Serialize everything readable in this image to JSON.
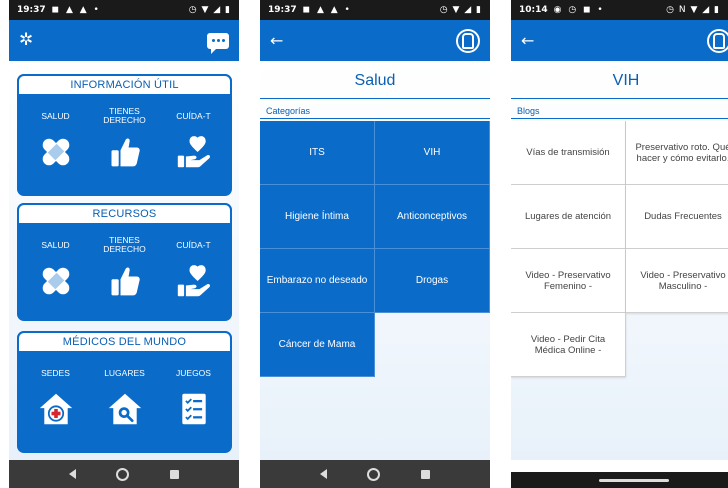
{
  "screen1": {
    "status": {
      "time": "19:37",
      "left_icons": "◼ ▲ ▲ •",
      "right_icons": "◷ ▼ ◢ ▮"
    },
    "appbar": {
      "settings_icon": "gear-icon",
      "chat_icon": "chat-icon"
    },
    "cards": [
      {
        "title": "INFORMACIÓN ÚTIL",
        "items": [
          {
            "label": "SALUD",
            "icon": "bandage-icon"
          },
          {
            "label": "TIENES DERECHO",
            "icon": "thumbs-up-icon"
          },
          {
            "label": "CUÍDA-T",
            "icon": "heart-hand-icon"
          }
        ]
      },
      {
        "title": "RECURSOS",
        "items": [
          {
            "label": "SALUD",
            "icon": "bandage-icon"
          },
          {
            "label": "TIENES DERECHO",
            "icon": "thumbs-up-icon"
          },
          {
            "label": "CUÍDA-T",
            "icon": "heart-hand-icon"
          }
        ]
      },
      {
        "title": "MÉDICOS DEL MUNDO",
        "items": [
          {
            "label": "SEDES",
            "icon": "medicos-house-icon"
          },
          {
            "label": "LUGARES",
            "icon": "house-search-icon"
          },
          {
            "label": "JUEGOS",
            "icon": "checklist-icon"
          }
        ]
      }
    ]
  },
  "screen2": {
    "status": {
      "time": "19:37",
      "left_icons": "◼ ▲ ▲ •",
      "right_icons": "◷ ▼ ◢ ▮"
    },
    "title": "Salud",
    "section": "Categorías",
    "categories": [
      "ITS",
      "VIH",
      "Higiene Íntima",
      "Anticonceptivos",
      "Embarazo no deseado",
      "Drogas",
      "Cáncer de Mama"
    ]
  },
  "screen3": {
    "status": {
      "time": "10:14",
      "left_icons": "◉ ◷ ◼ •",
      "right_icons": "◷ N ▼ ◢ ▮"
    },
    "title": "VIH",
    "section": "Blogs",
    "blogs": [
      "Vías de transmisión",
      "Preservativo roto. Qué hacer y cómo evitarlo.",
      "Lugares de atención",
      "Dudas Frecuentes",
      "Video - Preservativo Femenino -",
      "Video - Preservativo Masculino -",
      "Video - Pedir Cita Médica Online -"
    ]
  },
  "colors": {
    "primary": "#0a6bc8",
    "title_text": "#0a5fb3",
    "navbar": "#3a3a3a"
  }
}
